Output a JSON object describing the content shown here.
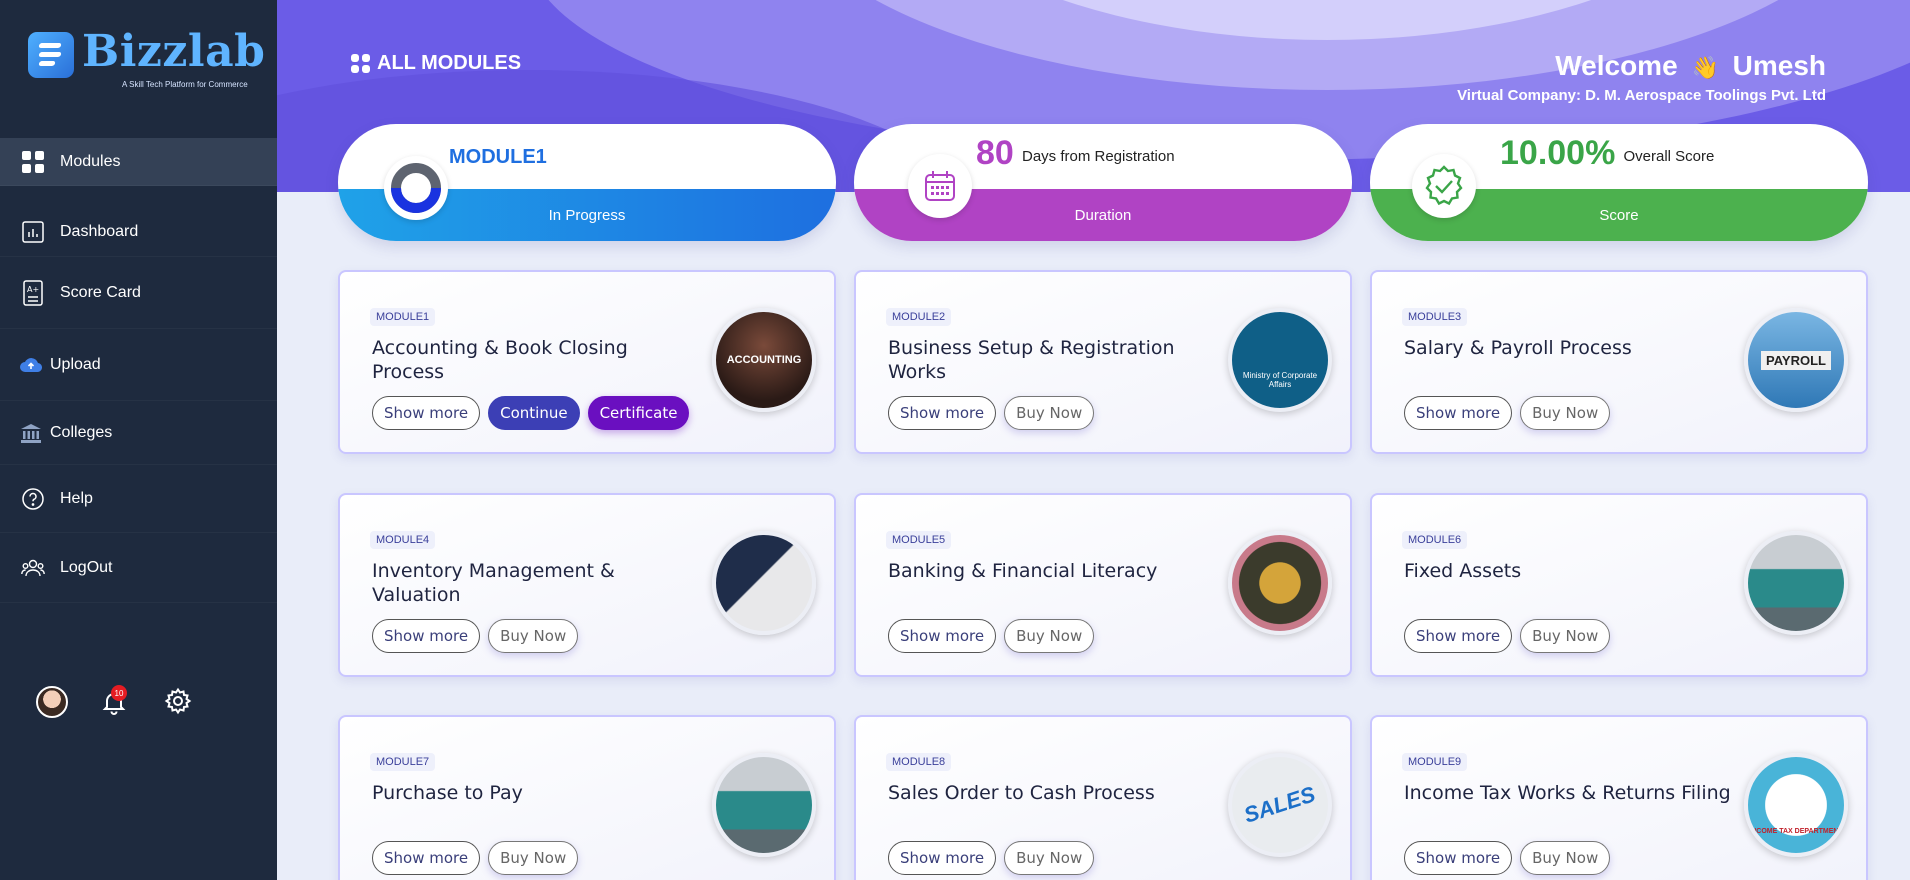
{
  "brand": {
    "name": "Bizzlab",
    "tagline": "A Skill Tech Platform for Commerce"
  },
  "sidebar": {
    "items": [
      {
        "label": "Modules",
        "icon": "grid-icon",
        "active": true
      },
      {
        "label": "Dashboard",
        "icon": "chart-icon"
      },
      {
        "label": "Score Card",
        "icon": "scorecard-icon"
      },
      {
        "label": "Upload",
        "icon": "cloud-upload-icon"
      },
      {
        "label": "Colleges",
        "icon": "college-icon"
      },
      {
        "label": "Help",
        "icon": "help-icon"
      },
      {
        "label": "LogOut",
        "icon": "logout-icon"
      }
    ],
    "notification_count": "10"
  },
  "header": {
    "section_title": "ALL MODULES",
    "welcome_text": "Welcome",
    "user_name": "Umesh",
    "company": "Virtual Company: D. M. Aerospace Toolings Pvt. Ltd"
  },
  "stats": {
    "module": {
      "title": "MODULE1",
      "caption": "In Progress",
      "progress": 0.33
    },
    "duration": {
      "value": "80",
      "text": "Days from Registration",
      "caption": "Duration"
    },
    "score": {
      "value": "10.00%",
      "text": "Overall Score",
      "caption": "Score"
    }
  },
  "buttons": {
    "show_more": "Show more",
    "buy_now": "Buy Now",
    "continue": "Continue",
    "certificate": "Certificate"
  },
  "modules": [
    {
      "tag": "MODULE1",
      "title": "Accounting & Book Closing Process",
      "image": "accounting-image",
      "image_text": "ACCOUNTING"
    },
    {
      "tag": "MODULE2",
      "title": "Business Setup & Registration Works",
      "image": "ministry-emblem-image",
      "image_text": "Ministry of Corporate Affairs"
    },
    {
      "tag": "MODULE3",
      "title": "Salary & Payroll Process",
      "image": "payroll-image",
      "image_text": "PAYROLL"
    },
    {
      "tag": "MODULE4",
      "title": "Inventory Management & Valuation",
      "image": "business-people-image",
      "image_text": ""
    },
    {
      "tag": "MODULE5",
      "title": "Banking & Financial Literacy",
      "image": "rbi-note-image",
      "image_text": ""
    },
    {
      "tag": "MODULE6",
      "title": "Fixed Assets",
      "image": "machinery-image",
      "image_text": ""
    },
    {
      "tag": "MODULE7",
      "title": "Purchase to Pay",
      "image": "machinery-image",
      "image_text": ""
    },
    {
      "tag": "MODULE8",
      "title": "Sales Order to Cash Process",
      "image": "sales-image",
      "image_text": "SALES"
    },
    {
      "tag": "MODULE9",
      "title": "Income Tax Works & Returns Filing",
      "image": "income-tax-emblem-image",
      "image_text": "INCOME TAX DEPARTMENT"
    }
  ],
  "colors": {
    "sidebar_bg": "#1e2a3e",
    "header_purple": "#6b5ce7",
    "stat_blue": "#1f8fe6",
    "stat_purple": "#b342c6",
    "stat_green": "#4cb14e",
    "accent_indigo": "#3c3fb5",
    "accent_violet": "#6a0fc0"
  }
}
